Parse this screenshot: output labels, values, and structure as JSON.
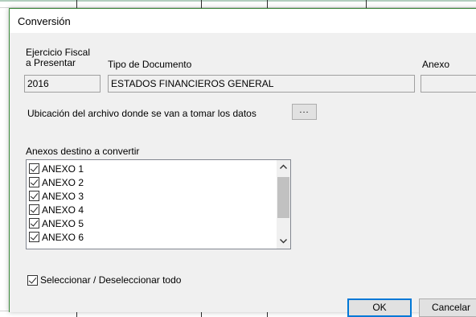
{
  "dialog": {
    "title": "Conversión"
  },
  "fields": {
    "fiscal_year_label_line1": "Ejercicio Fiscal",
    "fiscal_year_label_line2": "a Presentar",
    "fiscal_year_value": "2016",
    "doc_type_label": "Tipo de Documento",
    "doc_type_value": "ESTADOS FINANCIEROS GENERAL",
    "annex_label": "Anexo",
    "annex_value": ""
  },
  "file_location": {
    "label": "Ubicación del archivo donde se van a tomar los datos",
    "browse_label": "..."
  },
  "annexes": {
    "label": "Anexos destino a convertir",
    "items": [
      {
        "label": "ANEXO 1",
        "checked": true
      },
      {
        "label": "ANEXO 2",
        "checked": true
      },
      {
        "label": "ANEXO 3",
        "checked": true
      },
      {
        "label": "ANEXO 4",
        "checked": true
      },
      {
        "label": "ANEXO 5",
        "checked": true
      },
      {
        "label": "ANEXO 6",
        "checked": true
      }
    ],
    "scroll_up_icon": "chevron-up-icon",
    "scroll_down_icon": "chevron-down-icon"
  },
  "select_all": {
    "label": "Seleccionar / Deseleccionar todo",
    "checked": true
  },
  "buttons": {
    "ok": "OK",
    "cancel": "Cancelar"
  }
}
